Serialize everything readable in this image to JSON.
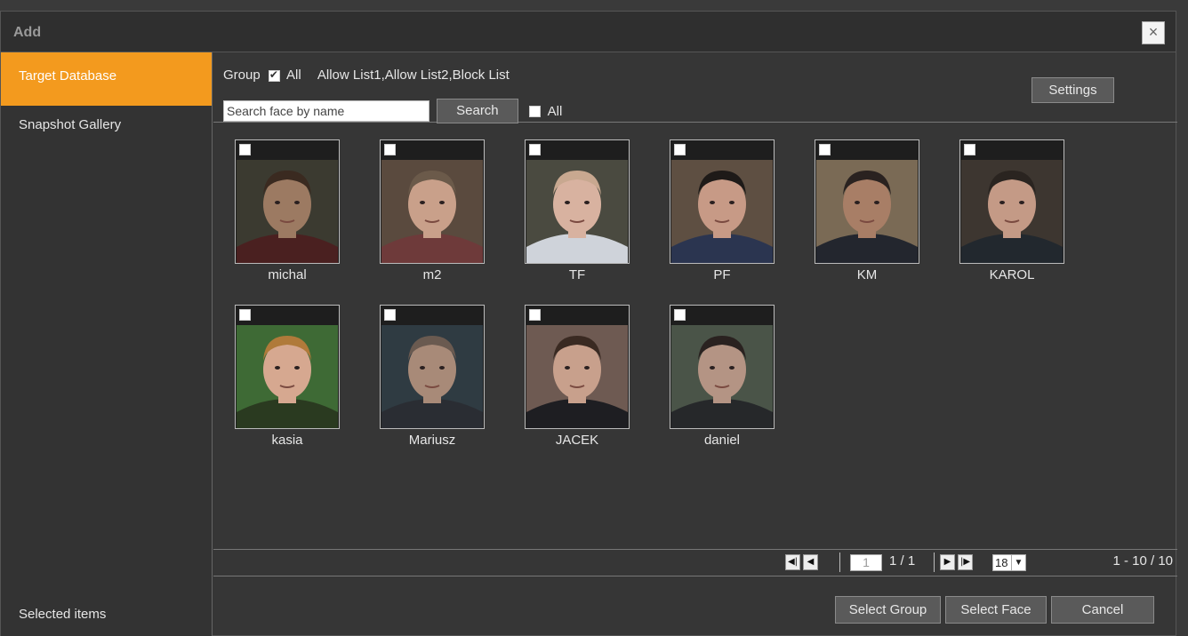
{
  "dialog": {
    "title": "Add",
    "close_symbol": "×"
  },
  "sidebar": {
    "items": [
      {
        "label": "Target Database",
        "active": true
      },
      {
        "label": "Snapshot Gallery",
        "active": false
      }
    ],
    "selected_items_label": "Selected items"
  },
  "toolbar": {
    "group_label": "Group",
    "group_all_label": "All",
    "group_all_checked": true,
    "groups_text": "Allow List1,Allow List2,Block List",
    "search_placeholder": "Search face by name",
    "search_button": "Search",
    "all_label": "All",
    "settings_button": "Settings"
  },
  "faces": [
    {
      "name": "michal"
    },
    {
      "name": "m2"
    },
    {
      "name": "TF"
    },
    {
      "name": "PF"
    },
    {
      "name": "KM"
    },
    {
      "name": "KAROL"
    },
    {
      "name": "kasia"
    },
    {
      "name": "Mariusz"
    },
    {
      "name": "JACEK"
    },
    {
      "name": "daniel"
    }
  ],
  "pager": {
    "first_icon": "first-page-icon",
    "prev_icon": "prev-page-icon",
    "next_icon": "next-page-icon",
    "last_icon": "last-page-icon",
    "current_page": "1",
    "total": "1 / 1",
    "page_size": "18",
    "range": "1 - 10 / 10"
  },
  "footer": {
    "select_group": "Select Group",
    "select_face": "Select Face",
    "cancel": "Cancel"
  },
  "colors": {
    "accent": "#f39a1e",
    "background": "#363636"
  }
}
